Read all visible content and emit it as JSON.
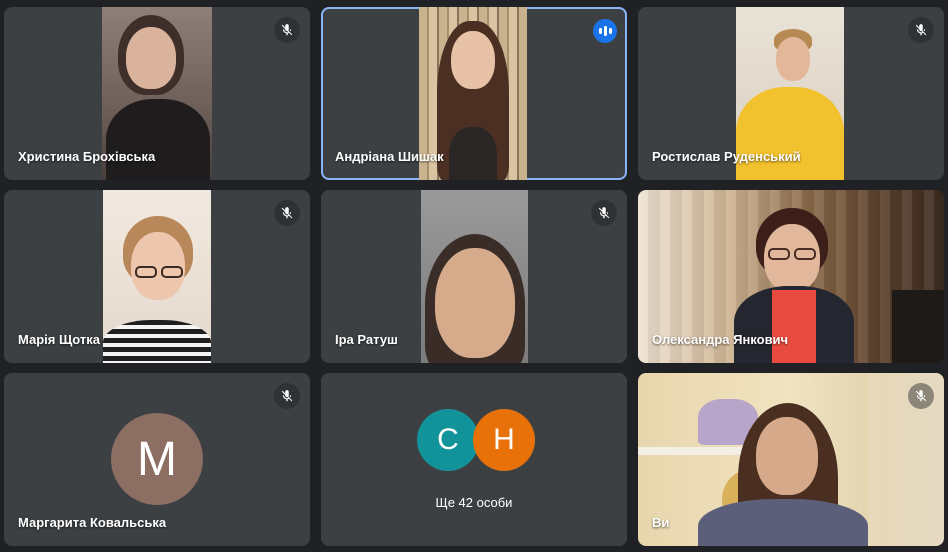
{
  "participants": [
    {
      "name": "Христина Брохівська",
      "muted": true
    },
    {
      "name": "Андріана Шишак",
      "speaking": true
    },
    {
      "name": "Ростислав Руденський",
      "muted": true
    },
    {
      "name": "Марія Щотка",
      "muted": true
    },
    {
      "name": "Іра Ратуш",
      "muted": true
    },
    {
      "name": "Олександра Янкович",
      "muted": false
    },
    {
      "name": "Маргарита Ковальська",
      "muted": true,
      "avatar_letter": "M",
      "avatar_color": "#8d6e63"
    },
    {
      "name": "Ви",
      "muted": true
    }
  ],
  "others": {
    "label": "Ще 42 особи",
    "avatars": [
      {
        "letter": "C",
        "color": "#12939a"
      },
      {
        "letter": "H",
        "color": "#e8710a"
      }
    ]
  },
  "colors": {
    "tile": "#3c4043",
    "background": "#202124",
    "active_outline": "#8ab4f8",
    "speaking_badge": "#1a73e8"
  }
}
